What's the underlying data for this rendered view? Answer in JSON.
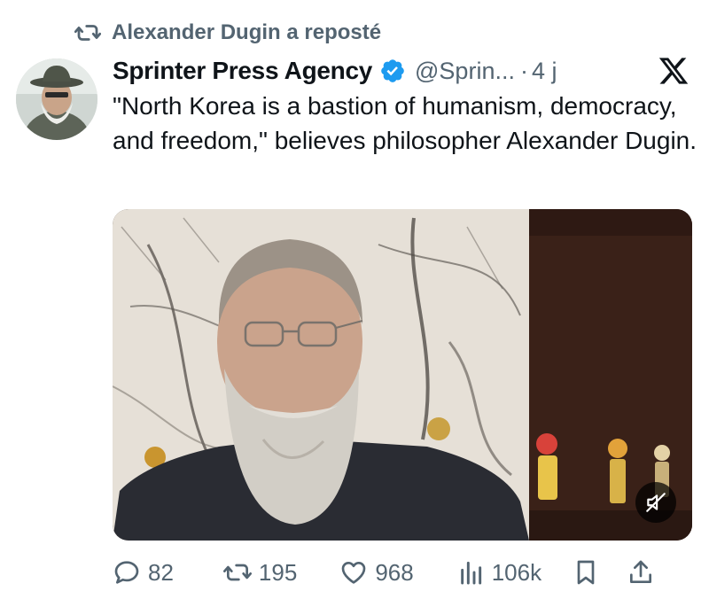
{
  "repost": {
    "text": "Alexander Dugin a reposté"
  },
  "tweet": {
    "author_name": "Sprinter Press Agency",
    "handle": "@Sprin...",
    "separator": "·",
    "time": "4 j",
    "text": "\"North Korea is a bastion of humanism, democracy, and freedom,\" believes philosopher Alexander Dugin."
  },
  "icons": {
    "repost": "repost-icon",
    "verified": "verified-badge-icon",
    "x_logo": "x-logo-icon",
    "mute": "muted-speaker-icon",
    "reply": "reply-icon",
    "retweet": "retweet-icon",
    "like": "heart-icon",
    "views": "views-icon",
    "bookmark": "bookmark-icon",
    "share": "share-icon"
  },
  "actions": {
    "replies": "82",
    "retweets": "195",
    "likes": "968",
    "views": "106k"
  },
  "colors": {
    "verified": "#1d9bf0",
    "secondary_text": "#536471",
    "primary_text": "#0f1419"
  }
}
